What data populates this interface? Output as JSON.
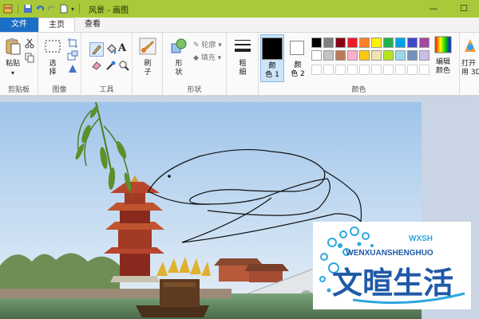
{
  "window": {
    "title": "风景 - 画图"
  },
  "tabs": {
    "file": "文件",
    "home": "主页",
    "view": "查看"
  },
  "ribbon": {
    "clipboard": {
      "paste": "粘贴",
      "label": "剪贴板"
    },
    "image": {
      "select": "选",
      "select2": "择",
      "label": "图像"
    },
    "tools": {
      "label": "工具"
    },
    "brushes": {
      "label1": "刷",
      "label2": "子"
    },
    "shapes": {
      "shape1": "形",
      "shape2": "状",
      "outline": "轮廓",
      "fill": "填充",
      "label": "形状"
    },
    "size": {
      "label1": "粗",
      "label2": "细"
    },
    "colors": {
      "color1_l1": "颜",
      "color1_l2": "色 1",
      "color2_l1": "颜",
      "color2_l2": "色 2",
      "edit_l1": "编辑",
      "edit_l2": "颜色",
      "label": "颜色"
    },
    "open3d": {
      "l1": "打开",
      "l2": "用 3D"
    },
    "palette": [
      "#000000",
      "#7f7f7f",
      "#880015",
      "#ed1c24",
      "#ff7f27",
      "#fff200",
      "#22b14c",
      "#00a2e8",
      "#3f48cc",
      "#a349a4",
      "#ffffff",
      "#c3c3c3",
      "#b97a57",
      "#ffaec9",
      "#ffc90e",
      "#efe4b0",
      "#b5e61d",
      "#99d9ea",
      "#7092be",
      "#c8bfe7"
    ],
    "color1": "#000000",
    "color2": "#ffffff"
  },
  "watermark": {
    "brand_pinyin": "WENXUANSHENGHUO",
    "brand_cn": "文暄生活",
    "badge": "WXSH"
  }
}
